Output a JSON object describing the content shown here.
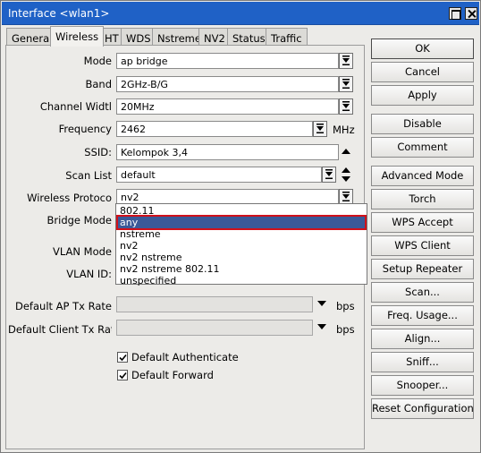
{
  "window": {
    "title": "Interface <wlan1>"
  },
  "tabs": [
    "General",
    "Wireless",
    "HT",
    "WDS",
    "Nstreme",
    "NV2",
    "Status",
    "Traffic"
  ],
  "form": {
    "mode": {
      "label": "Mode",
      "value": "ap bridge"
    },
    "band": {
      "label": "Band",
      "value": "2GHz-B/G"
    },
    "channel_width": {
      "label": "Channel Widtl",
      "value": "20MHz"
    },
    "frequency": {
      "label": "Frequency",
      "value": "2462",
      "unit": "MHz"
    },
    "ssid": {
      "label": "SSID:",
      "value": "Kelompok 3,4"
    },
    "scan_list": {
      "label": "Scan List",
      "value": "default"
    },
    "wireless_protocol": {
      "label": "Wireless Protoco",
      "value": "nv2"
    },
    "bridge_mode": {
      "label": "Bridge Mode"
    },
    "vlan_mode": {
      "label": "VLAN Mode"
    },
    "vlan_id": {
      "label": "VLAN ID:"
    },
    "default_ap_tx_rate": {
      "label": "Default AP Tx Rate",
      "value": "",
      "unit": "bps"
    },
    "default_client_tx_rate": {
      "label": "Default Client Tx Rat",
      "value": "",
      "unit": "bps"
    },
    "default_authenticate": {
      "label": "Default Authenticate",
      "checked": true
    },
    "default_forward": {
      "label": "Default Forward",
      "checked": true
    }
  },
  "protocol_dropdown": {
    "options": [
      "802.11",
      "any",
      "nstreme",
      "nv2",
      "nv2 nstreme",
      "nv2 nstreme 802.11",
      "unspecified"
    ],
    "highlighted": "any"
  },
  "buttons": [
    "OK",
    "Cancel",
    "Apply",
    "Disable",
    "Comment",
    "Advanced Mode",
    "Torch",
    "WPS Accept",
    "WPS Client",
    "Setup Repeater",
    "Scan...",
    "Freq. Usage...",
    "Align...",
    "Sniff...",
    "Snooper...",
    "Reset Configuration"
  ],
  "colors": {
    "titlebar": "#1f61c6",
    "highlight": "#3b5998",
    "highlight_outline": "#d0111b"
  }
}
